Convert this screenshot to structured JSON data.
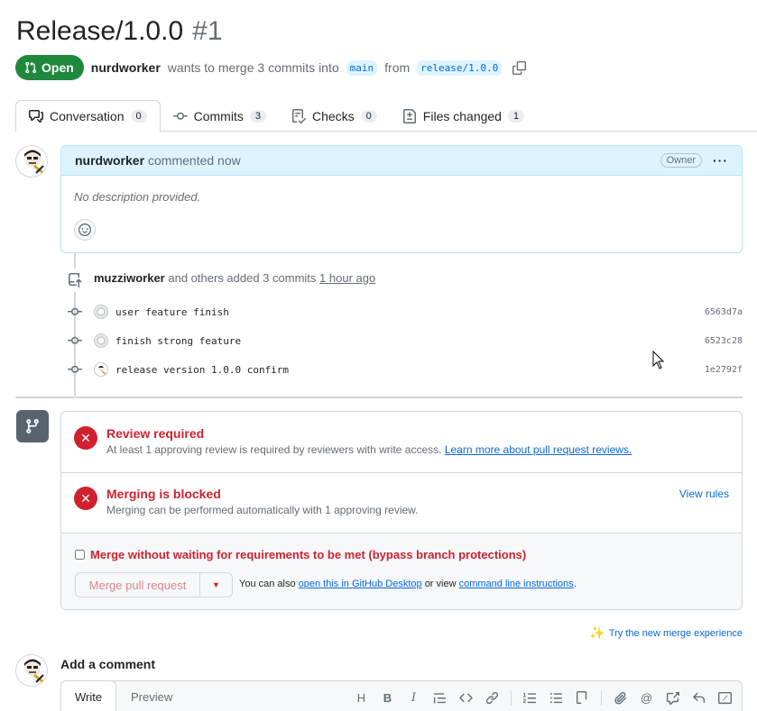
{
  "pr": {
    "title": "Release/1.0.0",
    "number": "#1",
    "state": "Open",
    "author": "nurdworker",
    "merge_text_1": "wants to merge 3 commits into",
    "base_branch": "main",
    "merge_text_2": "from",
    "head_branch": "release/1.0.0"
  },
  "tabs": [
    {
      "label": "Conversation",
      "count": "0"
    },
    {
      "label": "Commits",
      "count": "3"
    },
    {
      "label": "Checks",
      "count": "0"
    },
    {
      "label": "Files changed",
      "count": "1"
    }
  ],
  "comment": {
    "author": "nurdworker",
    "action": "commented now",
    "badge": "Owner",
    "body": "No description provided."
  },
  "push_event": {
    "author": "muzziworker",
    "text": "and others added 3 commits",
    "time": "1 hour ago"
  },
  "commits": [
    {
      "message": "user feature finish",
      "sha": "6563d7a"
    },
    {
      "message": "finish strong feature",
      "sha": "6523c28"
    },
    {
      "message": "release version 1.0.0 confirm",
      "sha": "1e2792f"
    }
  ],
  "merge": {
    "review_title": "Review required",
    "review_desc": "At least 1 approving review is required by reviewers with write access.",
    "review_link": "Learn more about pull request reviews.",
    "blocked_title": "Merging is blocked",
    "blocked_desc": "Merging can be performed automatically with 1 approving review.",
    "view_rules": "View rules",
    "bypass_label": "Merge without waiting for requirements to be met (bypass branch protections)",
    "merge_button": "Merge pull request",
    "also_text_1": "You can also",
    "desktop_link": "open this in GitHub Desktop",
    "also_text_2": "or view",
    "cli_link": "command line instructions",
    "also_text_3": "."
  },
  "try_new": "Try the new merge experience",
  "add_comment": {
    "title": "Add a comment",
    "write_tab": "Write",
    "preview_tab": "Preview"
  },
  "colors": {
    "open_green": "#1f883d",
    "danger_red": "#cf222e",
    "link_blue": "#0969da"
  }
}
